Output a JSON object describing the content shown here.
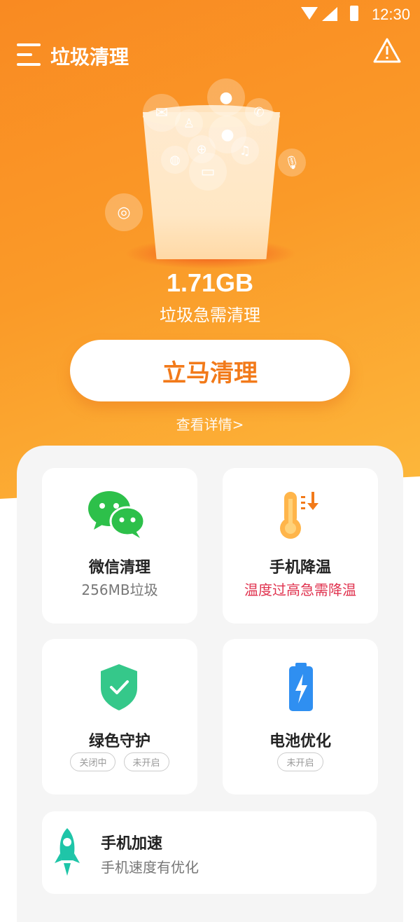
{
  "status_bar": {
    "time": "12:30"
  },
  "header": {
    "title": "垃圾清理"
  },
  "junk": {
    "size": "1.71GB",
    "label": "垃圾急需清理"
  },
  "actions": {
    "clean_now": "立马清理",
    "view_details": "查看详情>"
  },
  "cards": {
    "wechat": {
      "title": "微信清理",
      "subtitle": "256MB垃圾",
      "subtitle_color": "#777777"
    },
    "cool": {
      "title": "手机降温",
      "subtitle": "温度过高急需降温",
      "subtitle_color": "#e0334f"
    },
    "guard": {
      "title": "绿色守护",
      "chips": [
        "关闭中",
        "未开启"
      ]
    },
    "battery": {
      "title": "电池优化",
      "chips": [
        "未开启"
      ]
    },
    "boost": {
      "title": "手机加速",
      "subtitle": "手机速度有优化"
    }
  },
  "colors": {
    "brand": "#f98a22",
    "clean_button_text": "#f27a1a",
    "wechat_green": "#2dc04a",
    "shield_green": "#35c88a",
    "battery_blue": "#2f8ff1",
    "rocket_teal": "#1fc5a8"
  },
  "icons": [
    "menu-icon",
    "alert-icon",
    "mail-icon",
    "qq-icon",
    "chat-icon",
    "phone-icon",
    "gamepad-icon",
    "music-icon",
    "wechat-icon",
    "folder-icon",
    "weibo-icon",
    "mic-icon",
    "thermometer-icon",
    "shield-icon",
    "battery-icon",
    "rocket-icon"
  ]
}
